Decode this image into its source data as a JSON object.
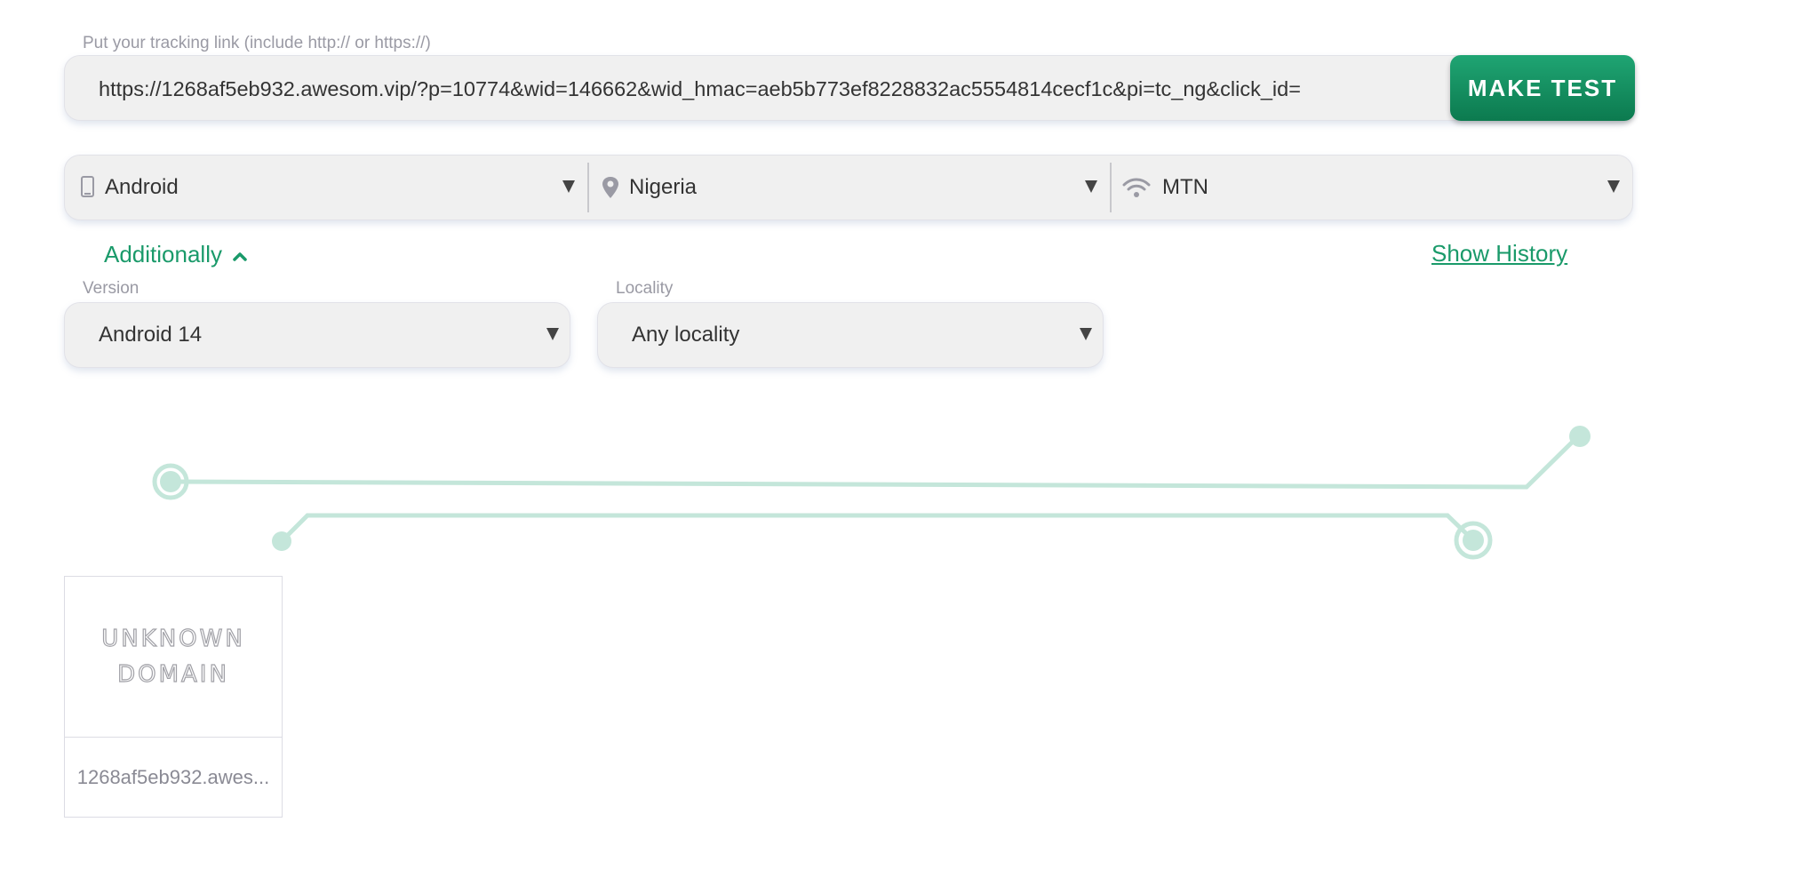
{
  "tracking": {
    "label": "Put your tracking link (include http:// or https://)",
    "url": "https://1268af5eb932.awesom.vip/?p=10774&wid=146662&wid_hmac=aeb5b773ef8228832ac5554814cecf1c&pi=tc_ng&click_id=",
    "button_label": "MAKE TEST"
  },
  "selectors": {
    "device": {
      "value": "Android",
      "icon": "phone-icon"
    },
    "country": {
      "value": "Nigeria",
      "icon": "location-pin-icon"
    },
    "carrier": {
      "value": "MTN",
      "icon": "wifi-icon"
    }
  },
  "options": {
    "additionally_label": "Additionally",
    "show_history_label": "Show History"
  },
  "fields": {
    "version": {
      "label": "Version",
      "value": "Android 14"
    },
    "locality": {
      "label": "Locality",
      "value": "Any locality"
    }
  },
  "result_card": {
    "logo_line1": "UNKNOWN",
    "logo_line2": "DOMAIN",
    "domain": "1268af5eb932.awes..."
  },
  "colors": {
    "accent": "#1a9a6a",
    "button_top": "#1fa573",
    "button_bottom": "#0c7a4f",
    "circuit": "#c4e6da"
  }
}
